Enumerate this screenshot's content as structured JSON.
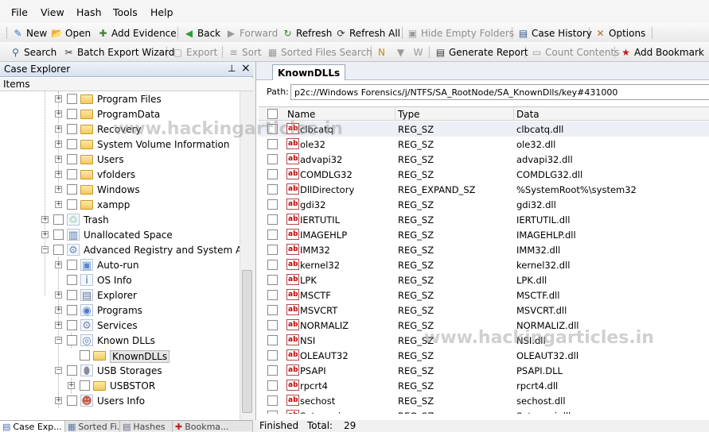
{
  "menu": [
    "File",
    "View",
    "Hash",
    "Tools",
    "Help"
  ],
  "toolbar1": [
    {
      "label": "New",
      "icon": "new-document-icon",
      "glyph": "✎",
      "color": "#2a6fc9",
      "disabled": false
    },
    {
      "label": "Open",
      "icon": "open-folder-icon",
      "glyph": "📂",
      "color": "#d09a2a",
      "disabled": false
    },
    {
      "label": "Add Evidence",
      "icon": "add-evidence-icon",
      "glyph": "✚",
      "color": "#4a7a3a",
      "disabled": false
    },
    {
      "label": "Back",
      "icon": "back-icon",
      "glyph": "◀",
      "color": "#2e9b3e",
      "disabled": false
    },
    {
      "label": "Forward",
      "icon": "forward-icon",
      "glyph": "▶",
      "color": "#9a9a9a",
      "disabled": true
    },
    {
      "label": "Refresh",
      "icon": "refresh-icon",
      "glyph": "↻",
      "color": "#2a8a2a",
      "disabled": false
    },
    {
      "label": "Refresh All",
      "icon": "refresh-all-icon",
      "glyph": "⟳",
      "color": "#333333",
      "disabled": false
    },
    {
      "label": "Hide Empty Folders",
      "icon": "hide-empty-folders-icon",
      "glyph": "▣",
      "color": "#9a9a9a",
      "disabled": true
    },
    {
      "label": "Case History",
      "icon": "case-history-icon",
      "glyph": "▤",
      "color": "#3a5a8a",
      "disabled": false
    },
    {
      "label": "Options",
      "icon": "options-icon",
      "glyph": "✕",
      "color": "#b06a2a",
      "disabled": false
    }
  ],
  "toolbar2": [
    {
      "label": "Search",
      "icon": "search-icon",
      "glyph": "⚲",
      "color": "#3a5a8a",
      "disabled": false
    },
    {
      "label": "Batch Export Wizard",
      "icon": "batch-export-icon",
      "glyph": "✂",
      "color": "#333333",
      "disabled": false
    },
    {
      "label": "Export",
      "icon": "export-icon",
      "glyph": "▢",
      "color": "#9a9a9a",
      "disabled": true
    },
    {
      "label": "Sort",
      "icon": "sort-icon",
      "glyph": "≡",
      "color": "#9a9a9a",
      "disabled": true
    },
    {
      "label": "Sorted Files Search",
      "icon": "sorted-files-search-icon",
      "glyph": "▦",
      "color": "#9a9a9a",
      "disabled": true
    },
    {
      "label": "",
      "icon": "notes-icon",
      "glyph": "N",
      "color": "#c08a1a",
      "disabled": false
    },
    {
      "label": "",
      "icon": "filter-icon",
      "glyph": "▼",
      "color": "#9a9a9a",
      "disabled": true
    },
    {
      "label": "",
      "icon": "filter-w-icon",
      "glyph": "W",
      "color": "#9a9a9a",
      "disabled": true
    },
    {
      "label": "Generate Report",
      "icon": "generate-report-icon",
      "glyph": "▤",
      "color": "#3a3a3a",
      "disabled": false
    },
    {
      "label": "Count Contents",
      "icon": "count-contents-icon",
      "glyph": "▭",
      "color": "#9a9a9a",
      "disabled": true
    },
    {
      "label": "Add Bookmark",
      "icon": "add-bookmark-icon",
      "glyph": "★",
      "color": "#c01a1a",
      "disabled": false
    }
  ],
  "leftpanel": {
    "title": "Case Explorer",
    "items_header": "Items",
    "tree": [
      {
        "label": "Program Files",
        "icon": "folder-icon",
        "exp": "+",
        "level": 2
      },
      {
        "label": "ProgramData",
        "icon": "folder-icon",
        "exp": "+",
        "level": 2
      },
      {
        "label": "Recovery",
        "icon": "folder-icon",
        "exp": "+",
        "level": 2
      },
      {
        "label": "System Volume Information",
        "icon": "folder-icon",
        "exp": "+",
        "level": 2
      },
      {
        "label": "Users",
        "icon": "folder-icon",
        "exp": "+",
        "level": 2
      },
      {
        "label": "vfolders",
        "icon": "folder-icon",
        "exp": "+",
        "level": 2
      },
      {
        "label": "Windows",
        "icon": "folder-icon",
        "exp": "+",
        "level": 2
      },
      {
        "label": "xampp",
        "icon": "folder-icon",
        "exp": "+",
        "level": 2
      },
      {
        "label": "Trash",
        "icon": "trash-icon",
        "exp": "+",
        "level": 1
      },
      {
        "label": "Unallocated Space",
        "icon": "unallocated-space-icon",
        "exp": "+",
        "level": 1
      },
      {
        "label": "Advanced Registry and System Analyz",
        "icon": "registry-analyzer-icon",
        "exp": "−",
        "level": 1
      },
      {
        "label": "Auto-run",
        "icon": "auto-run-icon",
        "exp": "+",
        "level": 2
      },
      {
        "label": "OS Info",
        "icon": "os-info-icon",
        "exp": "",
        "level": 2
      },
      {
        "label": "Explorer",
        "icon": "explorer-icon",
        "exp": "+",
        "level": 2
      },
      {
        "label": "Programs",
        "icon": "programs-icon",
        "exp": "+",
        "level": 2
      },
      {
        "label": "Services",
        "icon": "services-icon",
        "exp": "+",
        "level": 2
      },
      {
        "label": "Known DLLs",
        "icon": "known-dlls-icon",
        "exp": "−",
        "level": 2
      },
      {
        "label": "KnownDLLs",
        "icon": "folder-icon",
        "exp": "",
        "level": 3
      },
      {
        "label": "USB Storages",
        "icon": "usb-storages-icon",
        "exp": "−",
        "level": 2
      },
      {
        "label": "USBSTOR",
        "icon": "folder-icon",
        "exp": "+",
        "level": 3
      },
      {
        "label": "Users Info",
        "icon": "users-info-icon",
        "exp": "+",
        "level": 2
      }
    ]
  },
  "bottom_tabs": [
    "Case Exp...",
    "Sorted Fi...",
    "Hashes",
    "Bookma..."
  ],
  "rightpanel": {
    "tab": "KnownDLLs",
    "path_label": "Path:",
    "path": "p2c://Windows Forensics/j/NTFS/SA_RootNode/SA_KnownDlls/key#431000",
    "columns": [
      "Name",
      "Type",
      "Data"
    ],
    "rows": [
      [
        "clbcatq",
        "REG_SZ",
        "clbcatq.dll"
      ],
      [
        "ole32",
        "REG_SZ",
        "ole32.dll"
      ],
      [
        "advapi32",
        "REG_SZ",
        "advapi32.dll"
      ],
      [
        "COMDLG32",
        "REG_SZ",
        "COMDLG32.dll"
      ],
      [
        "DllDirectory",
        "REG_EXPAND_SZ",
        "%SystemRoot%\\system32"
      ],
      [
        "gdi32",
        "REG_SZ",
        "gdi32.dll"
      ],
      [
        "IERTUTIL",
        "REG_SZ",
        "IERTUTIL.dll"
      ],
      [
        "IMAGEHLP",
        "REG_SZ",
        "IMAGEHLP.dll"
      ],
      [
        "IMM32",
        "REG_SZ",
        "IMM32.dll"
      ],
      [
        "kernel32",
        "REG_SZ",
        "kernel32.dll"
      ],
      [
        "LPK",
        "REG_SZ",
        "LPK.dll"
      ],
      [
        "MSCTF",
        "REG_SZ",
        "MSCTF.dll"
      ],
      [
        "MSVCRT",
        "REG_SZ",
        "MSVCRT.dll"
      ],
      [
        "NORMALIZ",
        "REG_SZ",
        "NORMALIZ.dll"
      ],
      [
        "NSI",
        "REG_SZ",
        "NSI.dll"
      ],
      [
        "OLEAUT32",
        "REG_SZ",
        "OLEAUT32.dll"
      ],
      [
        "PSAPI",
        "REG_SZ",
        "PSAPI.DLL"
      ],
      [
        "rpcrt4",
        "REG_SZ",
        "rpcrt4.dll"
      ],
      [
        "sechost",
        "REG_SZ",
        "sechost.dll"
      ],
      [
        "Setupapi",
        "REG_SZ",
        "Setupapi.dll"
      ]
    ]
  },
  "status": {
    "state": "Finished",
    "total_label": "Total:",
    "total": "29"
  },
  "watermark": "www.hackingarticles.in",
  "colors": {
    "accent": "#c00000",
    "header": "#d7e1ef"
  }
}
